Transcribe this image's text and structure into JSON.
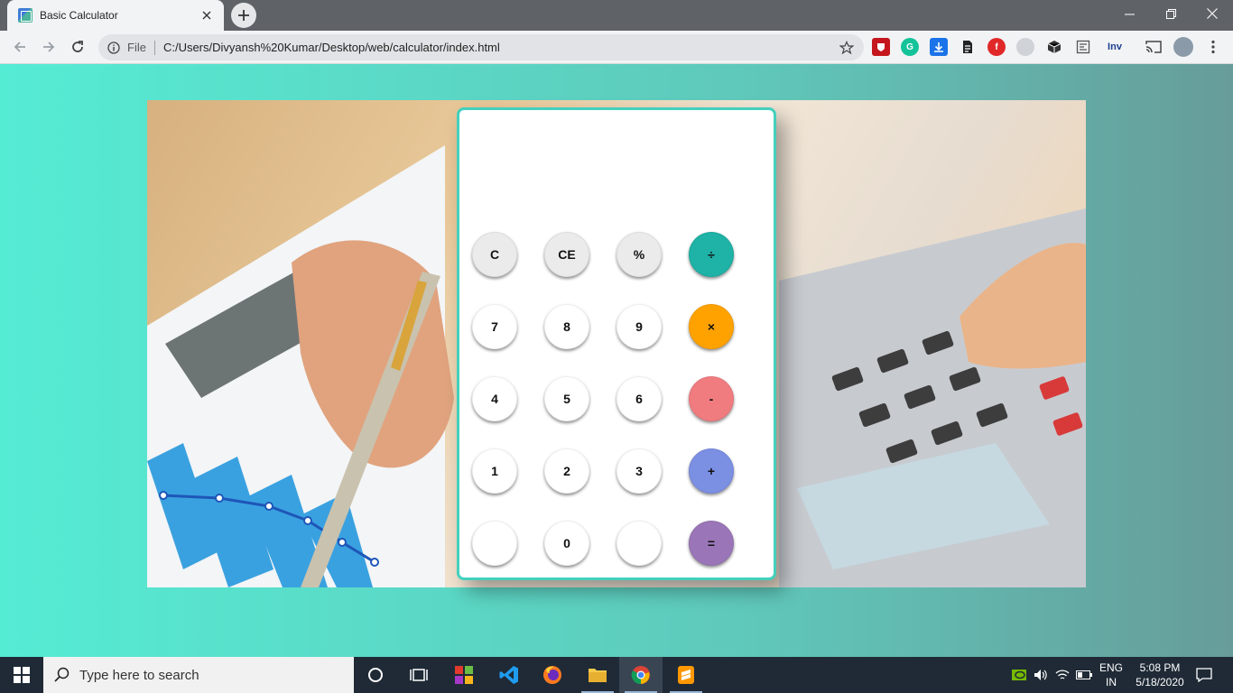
{
  "browser": {
    "tab_title": "Basic Calculator",
    "address_label": "File",
    "url": "C:/Users/Divyansh%20Kumar/Desktop/web/calculator/index.html",
    "extensions": [
      "ublock-icon",
      "grammarly-icon",
      "download-icon",
      "reader-icon",
      "flipboard-icon",
      "extension-icon",
      "cube-icon",
      "document-icon",
      "Inv",
      "cast-icon",
      "profile-avatar",
      "menu-icon"
    ]
  },
  "calculator": {
    "display": "",
    "rows": [
      [
        {
          "label": "C",
          "style": "grey"
        },
        {
          "label": "CE",
          "style": "grey"
        },
        {
          "label": "%",
          "style": "grey"
        },
        {
          "label": "÷",
          "color": "#1fb2a6"
        }
      ],
      [
        {
          "label": "7"
        },
        {
          "label": "8"
        },
        {
          "label": "9"
        },
        {
          "label": "×",
          "color": "#ffa200"
        }
      ],
      [
        {
          "label": "4"
        },
        {
          "label": "5"
        },
        {
          "label": "6"
        },
        {
          "label": "-",
          "color": "#f07c80"
        }
      ],
      [
        {
          "label": "1"
        },
        {
          "label": "2"
        },
        {
          "label": "3"
        },
        {
          "label": "+",
          "color": "#7b8fe3"
        }
      ],
      [
        {
          "label": ""
        },
        {
          "label": "0"
        },
        {
          "label": ""
        },
        {
          "label": "=",
          "color": "#9a76b8"
        }
      ]
    ]
  },
  "taskbar": {
    "search_placeholder": "Type here to search",
    "language": "ENG",
    "region": "IN",
    "time": "5:08 PM",
    "date": "5/18/2020"
  }
}
